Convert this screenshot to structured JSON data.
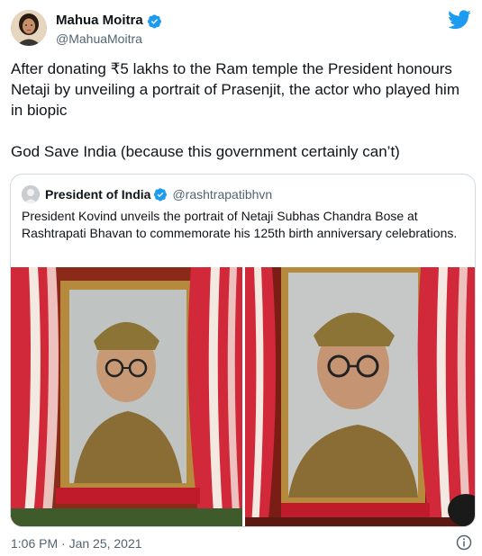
{
  "author": {
    "name": "Mahua Moitra",
    "handle": "@MahuaMoitra",
    "verified_icon": "verified-badge-icon"
  },
  "tweet": {
    "line1": "After donating ₹5 lakhs to the Ram temple the President honours Netaji by unveiling a portrait of Prasenjit, the actor who played him in biopic",
    "line2": "God Save India (because this government certainly can’t)"
  },
  "quoted": {
    "name": "President of India",
    "handle": "@rashtrapatibhvn",
    "text": "President Kovind unveils the portrait of Netaji Subhas Chandra Bose at Rashtrapati Bhavan to commemorate his 125th birth anniversary celebrations."
  },
  "meta": {
    "timestamp": "1:06 PM · Jan 25, 2021"
  },
  "colors": {
    "twitter_blue": "#1d9bf0",
    "text_primary": "#0f1419",
    "text_secondary": "#536471",
    "border": "#cfd9de"
  },
  "icons": [
    "twitter-bird-icon",
    "verified-badge-icon",
    "info-icon"
  ]
}
